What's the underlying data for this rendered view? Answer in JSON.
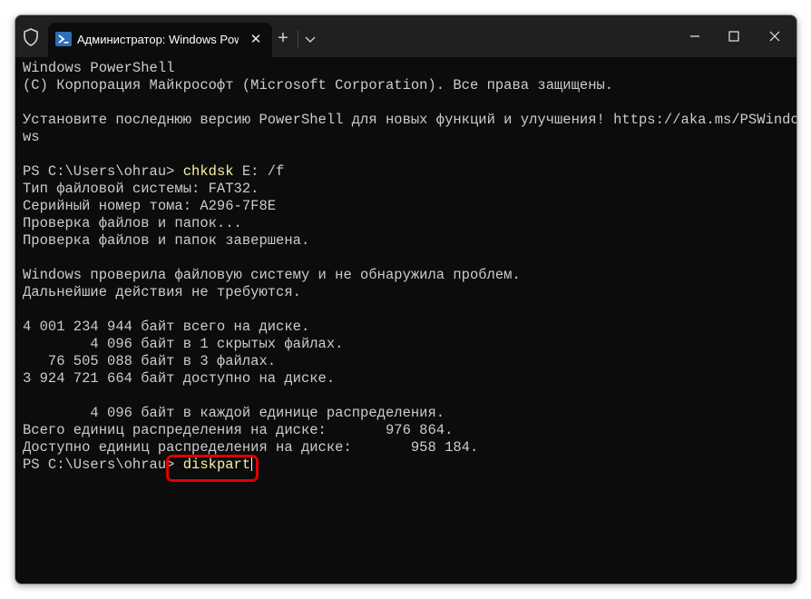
{
  "window": {
    "tab_title": "Администратор: Windows PowerShell",
    "icons": {
      "shield": "shield-icon",
      "powershell": "powershell-icon",
      "tab_close": "close-icon",
      "new_tab": "plus-icon",
      "dropdown": "chevron-down-icon",
      "minimize": "minimize-icon",
      "maximize": "maximize-icon",
      "close": "close-icon"
    },
    "colors": {
      "terminal_bg": "#0c0c0c",
      "titlebar_bg": "#202020",
      "text": "#cccccc",
      "command": "#f9f1a5",
      "highlight": "#e00000"
    }
  },
  "terminal": {
    "lines": [
      "Windows PowerShell",
      "(C) Корпорация Майкрософт (Microsoft Corporation). Все права защищены.",
      "",
      "Установите последнюю версию PowerShell для новых функций и улучшения! https://aka.ms/PSWindo",
      "ws",
      "",
      "",
      "Тип файловой системы: FAT32.",
      "Серийный номер тома: A296-7F8E",
      "Проверка файлов и папок...",
      "Проверка файлов и папок завершена.",
      "",
      "Windows проверила файловую систему и не обнаружила проблем.",
      "Дальнейшие действия не требуются.",
      "",
      "4 001 234 944 байт всего на диске.",
      "        4 096 байт в 1 скрытых файлах.",
      "   76 505 088 байт в 3 файлах.",
      "3 924 721 664 байт доступно на диске.",
      "",
      "        4 096 байт в каждой единице распределения.",
      "Всего единиц распределения на диске:       976 864.",
      "Доступно единиц распределения на диске:       958 184."
    ],
    "prompt1": {
      "prompt": "PS C:\\Users\\ohrau> ",
      "command": "chkdsk",
      "args": " E: /f"
    },
    "prompt2": {
      "prompt": "PS C:\\Users\\ohrau> ",
      "command": "diskpart"
    }
  }
}
